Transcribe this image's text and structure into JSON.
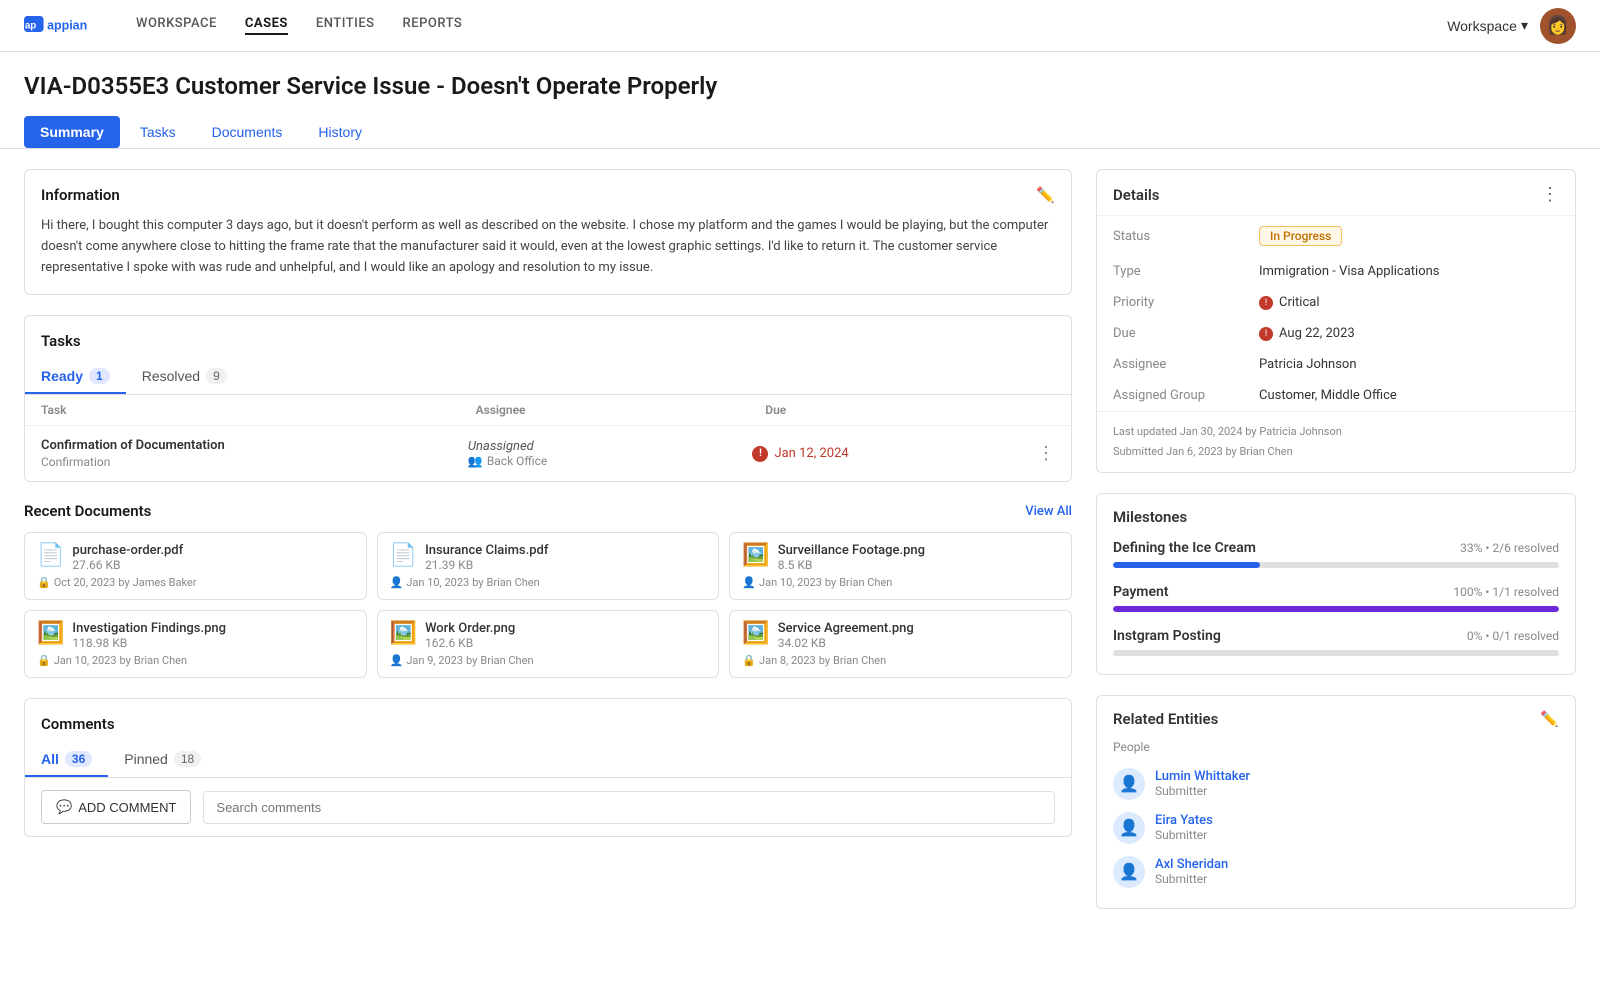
{
  "app": {
    "logo_text": "appian"
  },
  "nav": {
    "links": [
      {
        "id": "workspace",
        "label": "WORKSPACE",
        "active": false
      },
      {
        "id": "cases",
        "label": "CASES",
        "active": true
      },
      {
        "id": "entities",
        "label": "ENTITIES",
        "active": false
      },
      {
        "id": "reports",
        "label": "REPORTS",
        "active": false
      }
    ],
    "workspace_label": "Workspace",
    "workspace_caret": "▾"
  },
  "page": {
    "title": "VIA-D0355E3 Customer Service Issue - Doesn't Operate Properly"
  },
  "tabs": [
    {
      "id": "summary",
      "label": "Summary",
      "active": true
    },
    {
      "id": "tasks",
      "label": "Tasks",
      "active": false
    },
    {
      "id": "documents",
      "label": "Documents",
      "active": false
    },
    {
      "id": "history",
      "label": "History",
      "active": false
    }
  ],
  "information": {
    "title": "Information",
    "body": "Hi there, I bought this computer 3 days ago, but it doesn't perform as well as described on the website. I chose my platform and the games I would be playing, but the computer doesn't come anywhere close to hitting the frame rate that the manufacturer said it would, even at the lowest graphic settings. I'd like to return it. The customer service representative I spoke with was rude and unhelpful, and I would like an apology and resolution to my issue."
  },
  "tasks": {
    "title": "Tasks",
    "tabs": [
      {
        "id": "ready",
        "label": "Ready",
        "count": 1,
        "active": true
      },
      {
        "id": "resolved",
        "label": "Resolved",
        "count": 9,
        "active": false
      }
    ],
    "columns": [
      "Task",
      "Assignee",
      "Due"
    ],
    "rows": [
      {
        "name": "Confirmation of Documentation",
        "sub": "Confirmation",
        "assignee_name": "Unassigned",
        "assignee_group": "Back Office",
        "due": "Jan 12, 2024",
        "overdue": true
      }
    ]
  },
  "documents": {
    "title": "Recent Documents",
    "view_all": "View All",
    "files": [
      {
        "name": "purchase-order.pdf",
        "size": "27.66 KB",
        "date": "Oct 20, 2023",
        "author": "James Baker",
        "type": "pdf",
        "locked": true
      },
      {
        "name": "Insurance Claims.pdf",
        "size": "21.39 KB",
        "date": "Jan 10, 2023",
        "author": "Brian Chen",
        "type": "pdf",
        "locked": false
      },
      {
        "name": "Surveillance Footage.png",
        "size": "8.5 KB",
        "date": "Jan 10, 2023",
        "author": "Brian Chen",
        "type": "png",
        "locked": false
      },
      {
        "name": "Investigation Findings.png",
        "size": "118.98 KB",
        "date": "Jan 10, 2023",
        "author": "Brian Chen",
        "type": "png",
        "locked": true
      },
      {
        "name": "Work Order.png",
        "size": "162.6 KB",
        "date": "Jan 9, 2023",
        "author": "Brian Chen",
        "type": "png",
        "locked": false
      },
      {
        "name": "Service Agreement.png",
        "size": "34.02 KB",
        "date": "Jan 8, 2023",
        "author": "Brian Chen",
        "type": "png",
        "locked": true
      }
    ]
  },
  "comments": {
    "title": "Comments",
    "tabs": [
      {
        "id": "all",
        "label": "All",
        "count": 36,
        "active": true
      },
      {
        "id": "pinned",
        "label": "Pinned",
        "count": 18,
        "active": false
      }
    ],
    "add_label": "ADD COMMENT",
    "search_placeholder": "Search comments"
  },
  "details": {
    "title": "Details",
    "status": "In Progress",
    "type": "Immigration - Visa Applications",
    "priority": "Critical",
    "due": "Aug 22, 2023",
    "assignee": "Patricia Johnson",
    "assigned_group": "Customer, Middle Office",
    "last_updated": "Last updated Jan 30, 2024 by Patricia Johnson",
    "submitted": "Submitted Jan 6, 2023 by Brian Chen"
  },
  "milestones": {
    "title": "Milestones",
    "items": [
      {
        "name": "Defining the Ice Cream",
        "percent": 33,
        "stat": "33% • 2/6 resolved",
        "color": "blue"
      },
      {
        "name": "Payment",
        "percent": 100,
        "stat": "100% • 1/1 resolved",
        "color": "purple"
      },
      {
        "name": "Instgram Posting",
        "percent": 0,
        "stat": "0% • 0/1 resolved",
        "color": "orange"
      }
    ]
  },
  "related_entities": {
    "title": "Related Entities",
    "people_label": "People",
    "people": [
      {
        "name": "Lumin Whittaker",
        "role": "Submitter"
      },
      {
        "name": "Eira Yates",
        "role": "Submitter"
      },
      {
        "name": "Axl Sheridan",
        "role": "Submitter"
      }
    ]
  }
}
